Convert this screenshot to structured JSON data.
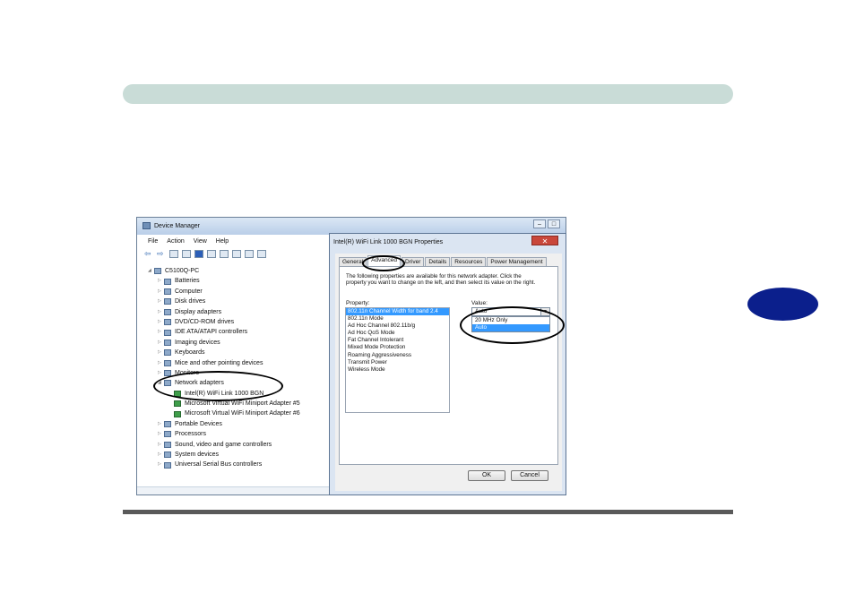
{
  "device_manager": {
    "title": "Device Manager",
    "window_buttons": [
      "–",
      "□"
    ],
    "menu": [
      "File",
      "Action",
      "View",
      "Help"
    ],
    "tree": [
      {
        "label": "C5100Q-PC",
        "expander": "◢",
        "indent": 0
      },
      {
        "label": "Batteries",
        "expander": "▷",
        "indent": 1
      },
      {
        "label": "Computer",
        "expander": "▷",
        "indent": 1
      },
      {
        "label": "Disk drives",
        "expander": "▷",
        "indent": 1
      },
      {
        "label": "Display adapters",
        "expander": "▷",
        "indent": 1
      },
      {
        "label": "DVD/CD-ROM drives",
        "expander": "▷",
        "indent": 1
      },
      {
        "label": "IDE ATA/ATAPI controllers",
        "expander": "▷",
        "indent": 1
      },
      {
        "label": "Imaging devices",
        "expander": "▷",
        "indent": 1
      },
      {
        "label": "Keyboards",
        "expander": "▷",
        "indent": 1
      },
      {
        "label": "Mice and other pointing devices",
        "expander": "▷",
        "indent": 1
      },
      {
        "label": "Monitors",
        "expander": "▷",
        "indent": 1
      },
      {
        "label": "Network adapters",
        "expander": "◢",
        "indent": 1
      },
      {
        "label": "Intel(R) WiFi Link 1000 BGN",
        "expander": "",
        "indent": 2
      },
      {
        "label": "Microsoft Virtual WiFi Miniport Adapter #5",
        "expander": "",
        "indent": 2
      },
      {
        "label": "Microsoft Virtual WiFi Miniport Adapter #6",
        "expander": "",
        "indent": 2
      },
      {
        "label": "Portable Devices",
        "expander": "▷",
        "indent": 1
      },
      {
        "label": "Processors",
        "expander": "▷",
        "indent": 1
      },
      {
        "label": "Sound, video and game controllers",
        "expander": "▷",
        "indent": 1
      },
      {
        "label": "System devices",
        "expander": "▷",
        "indent": 1
      },
      {
        "label": "Universal Serial Bus controllers",
        "expander": "▷",
        "indent": 1
      }
    ]
  },
  "properties_dialog": {
    "title": "Intel(R) WiFi Link 1000 BGN Properties",
    "close_label": "✕",
    "tabs": [
      "General",
      "Advanced",
      "Driver",
      "Details",
      "Resources",
      "Power Management"
    ],
    "active_tab": "Advanced",
    "description": "The following properties are available for this network adapter. Click the property you want to change on the left, and then select its value on the right.",
    "property_label": "Property:",
    "value_label": "Value:",
    "properties": [
      "802.11n Channel Width for band 2.4",
      "802.11n Mode",
      "Ad Hoc Channel 802.11b/g",
      "Ad Hoc QoS Mode",
      "Fat Channel Intolerant",
      "Mixed Mode Protection",
      "Roaming Aggressiveness",
      "Transmit Power",
      "Wireless Mode"
    ],
    "selected_property": "802.11n Channel Width for band 2.4",
    "value_selected": "Auto",
    "value_options": [
      "20 MHz Only",
      "Auto"
    ],
    "highlighted_option": "Auto",
    "ok_label": "OK",
    "cancel_label": "Cancel"
  },
  "colors": {
    "header_bar": "#c9dcd7",
    "chapter_tab": "#0b1f8c",
    "rule": "#5a5a5a",
    "selection": "#3399ff"
  }
}
